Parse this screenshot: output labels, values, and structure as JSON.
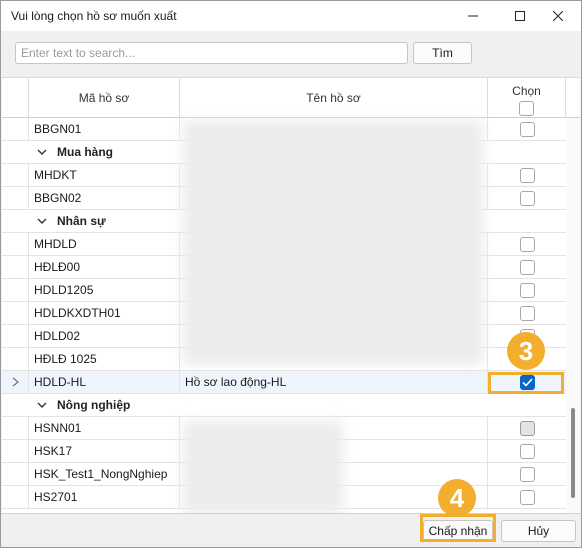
{
  "window": {
    "title": "Vui lòng chọn hồ sơ muốn xuất"
  },
  "toolbar": {
    "search_placeholder": "Enter text to search...",
    "find_label": "Tìm"
  },
  "grid": {
    "columns": {
      "code": "Mã hồ sơ",
      "name": "Tên hồ sơ",
      "select": "Chọn"
    },
    "rows": [
      {
        "type": "data",
        "code": "BBGN01",
        "name": "",
        "checked": false
      },
      {
        "type": "group",
        "label": "Mua hàng"
      },
      {
        "type": "data",
        "code": "MHDKT",
        "name": "",
        "checked": false
      },
      {
        "type": "data",
        "code": "BBGN02",
        "name": "",
        "checked": false
      },
      {
        "type": "group",
        "label": "Nhân sự"
      },
      {
        "type": "data",
        "code": "MHDLD",
        "name": "",
        "checked": false
      },
      {
        "type": "data",
        "code": "HĐLĐ00",
        "name": "",
        "checked": false
      },
      {
        "type": "data",
        "code": "HDLD1205",
        "name": "",
        "checked": false
      },
      {
        "type": "data",
        "code": "HDLDKXDTH01",
        "name": "",
        "checked": false
      },
      {
        "type": "data",
        "code": "HDLD02",
        "name": "",
        "checked": false
      },
      {
        "type": "data",
        "code": "HĐLĐ 1025",
        "name": "",
        "checked": false
      },
      {
        "type": "data",
        "code": "HDLD-HL",
        "name": "Hồ sơ lao động-HL",
        "checked": true,
        "selected": true
      },
      {
        "type": "group",
        "label": "Nông nghiệp"
      },
      {
        "type": "data",
        "code": "HSNN01",
        "name": "",
        "checked": false,
        "grey": true
      },
      {
        "type": "data",
        "code": "HSK17",
        "name": "",
        "checked": false
      },
      {
        "type": "data",
        "code": "HSK_Test1_NongNghiep",
        "name": "",
        "checked": false
      },
      {
        "type": "data",
        "code": "HS2701",
        "name": "",
        "checked": false
      }
    ]
  },
  "footer": {
    "accept_label": "Chấp nhận",
    "cancel_label": "Hủy"
  },
  "annotations": {
    "step3": "3",
    "step4": "4",
    "color": "#f2ae2c"
  }
}
